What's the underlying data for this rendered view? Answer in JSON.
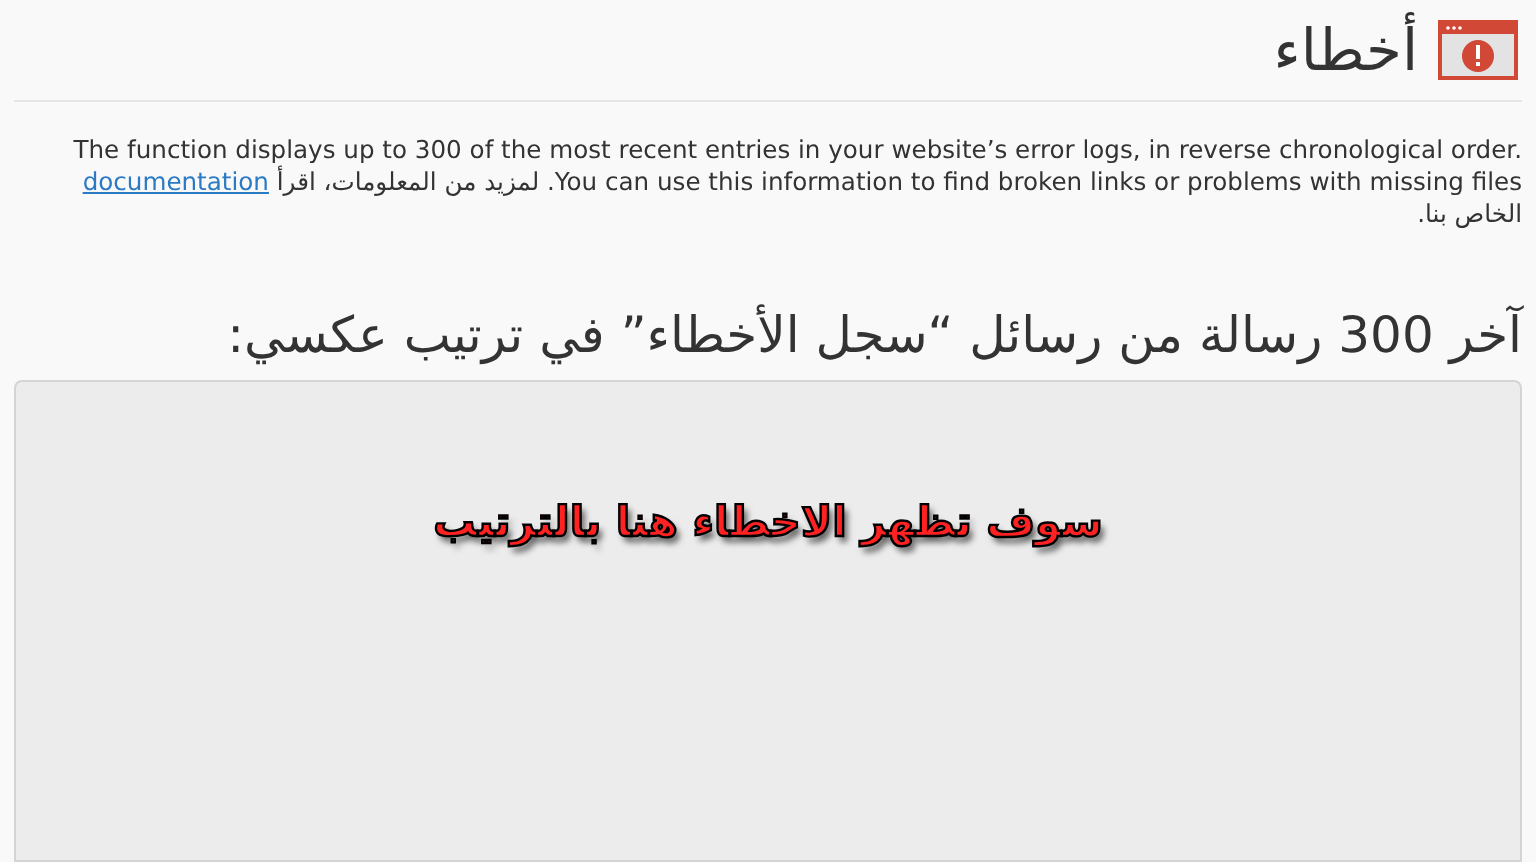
{
  "page": {
    "title": "أخطاء"
  },
  "description": {
    "text": "The function displays up to 300 of the most recent entries in your website’s error logs, in reverse chronological order. You can use this information to find broken links or problems with missing files. لمزيد من المعلومات، اقرأ",
    "link": "documentation",
    "text_end": "الخاص بنا."
  },
  "log_section": {
    "heading": "آخر 300 رسالة من رسائل “سجل الأخطاء” في ترتيب عكسي:",
    "overlay_note": "سوف تظهر الاخطاء هنا بالترتيب"
  }
}
